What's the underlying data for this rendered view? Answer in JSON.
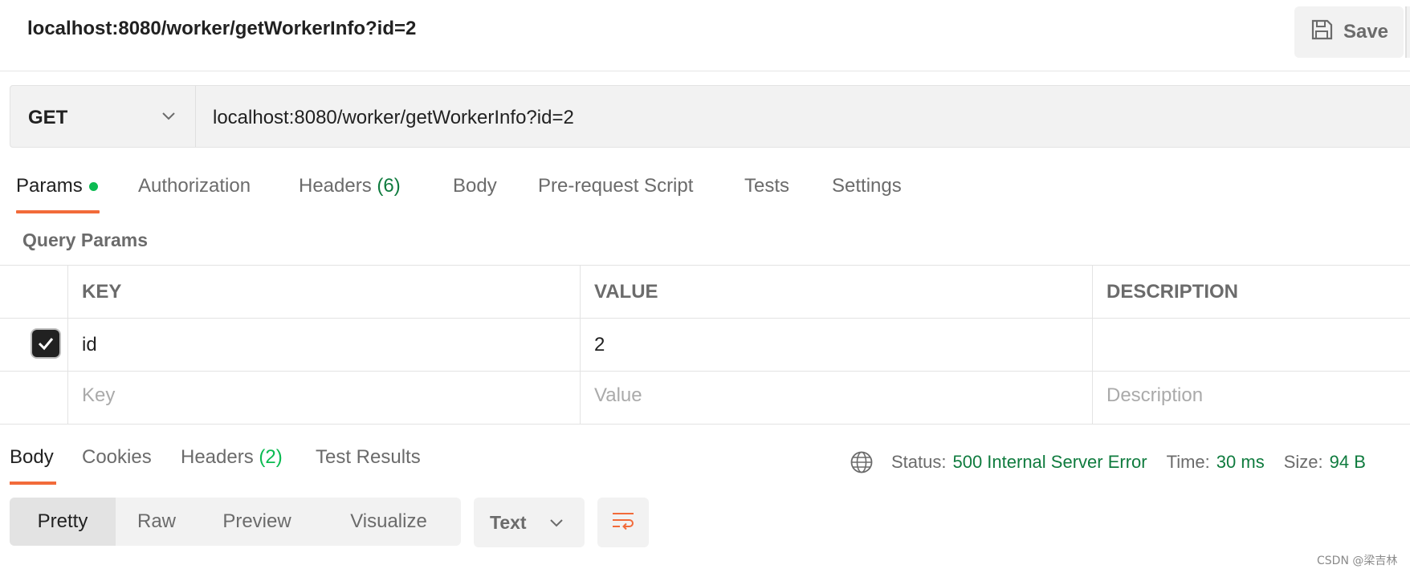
{
  "request": {
    "title": "localhost:8080/worker/getWorkerInfo?id=2",
    "save_label": "Save",
    "method": "GET",
    "url": "localhost:8080/worker/getWorkerInfo?id=2"
  },
  "request_tabs": {
    "params": "Params",
    "authorization": "Authorization",
    "headers": "Headers",
    "headers_count": "(6)",
    "body": "Body",
    "pre_request": "Pre-request Script",
    "tests": "Tests",
    "settings": "Settings"
  },
  "query_params": {
    "title": "Query Params",
    "columns": [
      "KEY",
      "VALUE",
      "DESCRIPTION"
    ],
    "rows": [
      {
        "checked": true,
        "key": "id",
        "value": "2",
        "description": ""
      }
    ],
    "placeholders": {
      "key": "Key",
      "value": "Value",
      "description": "Description"
    }
  },
  "response_tabs": {
    "body": "Body",
    "cookies": "Cookies",
    "headers": "Headers",
    "headers_count": "(2)",
    "test_results": "Test Results"
  },
  "response_status": {
    "status_label": "Status:",
    "status_value": "500 Internal Server Error",
    "time_label": "Time:",
    "time_value": "30 ms",
    "size_label": "Size:",
    "size_value": "94 B"
  },
  "view_modes": [
    "Pretty",
    "Raw",
    "Preview",
    "Visualize"
  ],
  "format": "Text",
  "watermark": "CSDN @梁吉林",
  "colors": {
    "accent": "#f26b3a",
    "success": "#0f7b3e",
    "dot": "#0cbb52"
  }
}
